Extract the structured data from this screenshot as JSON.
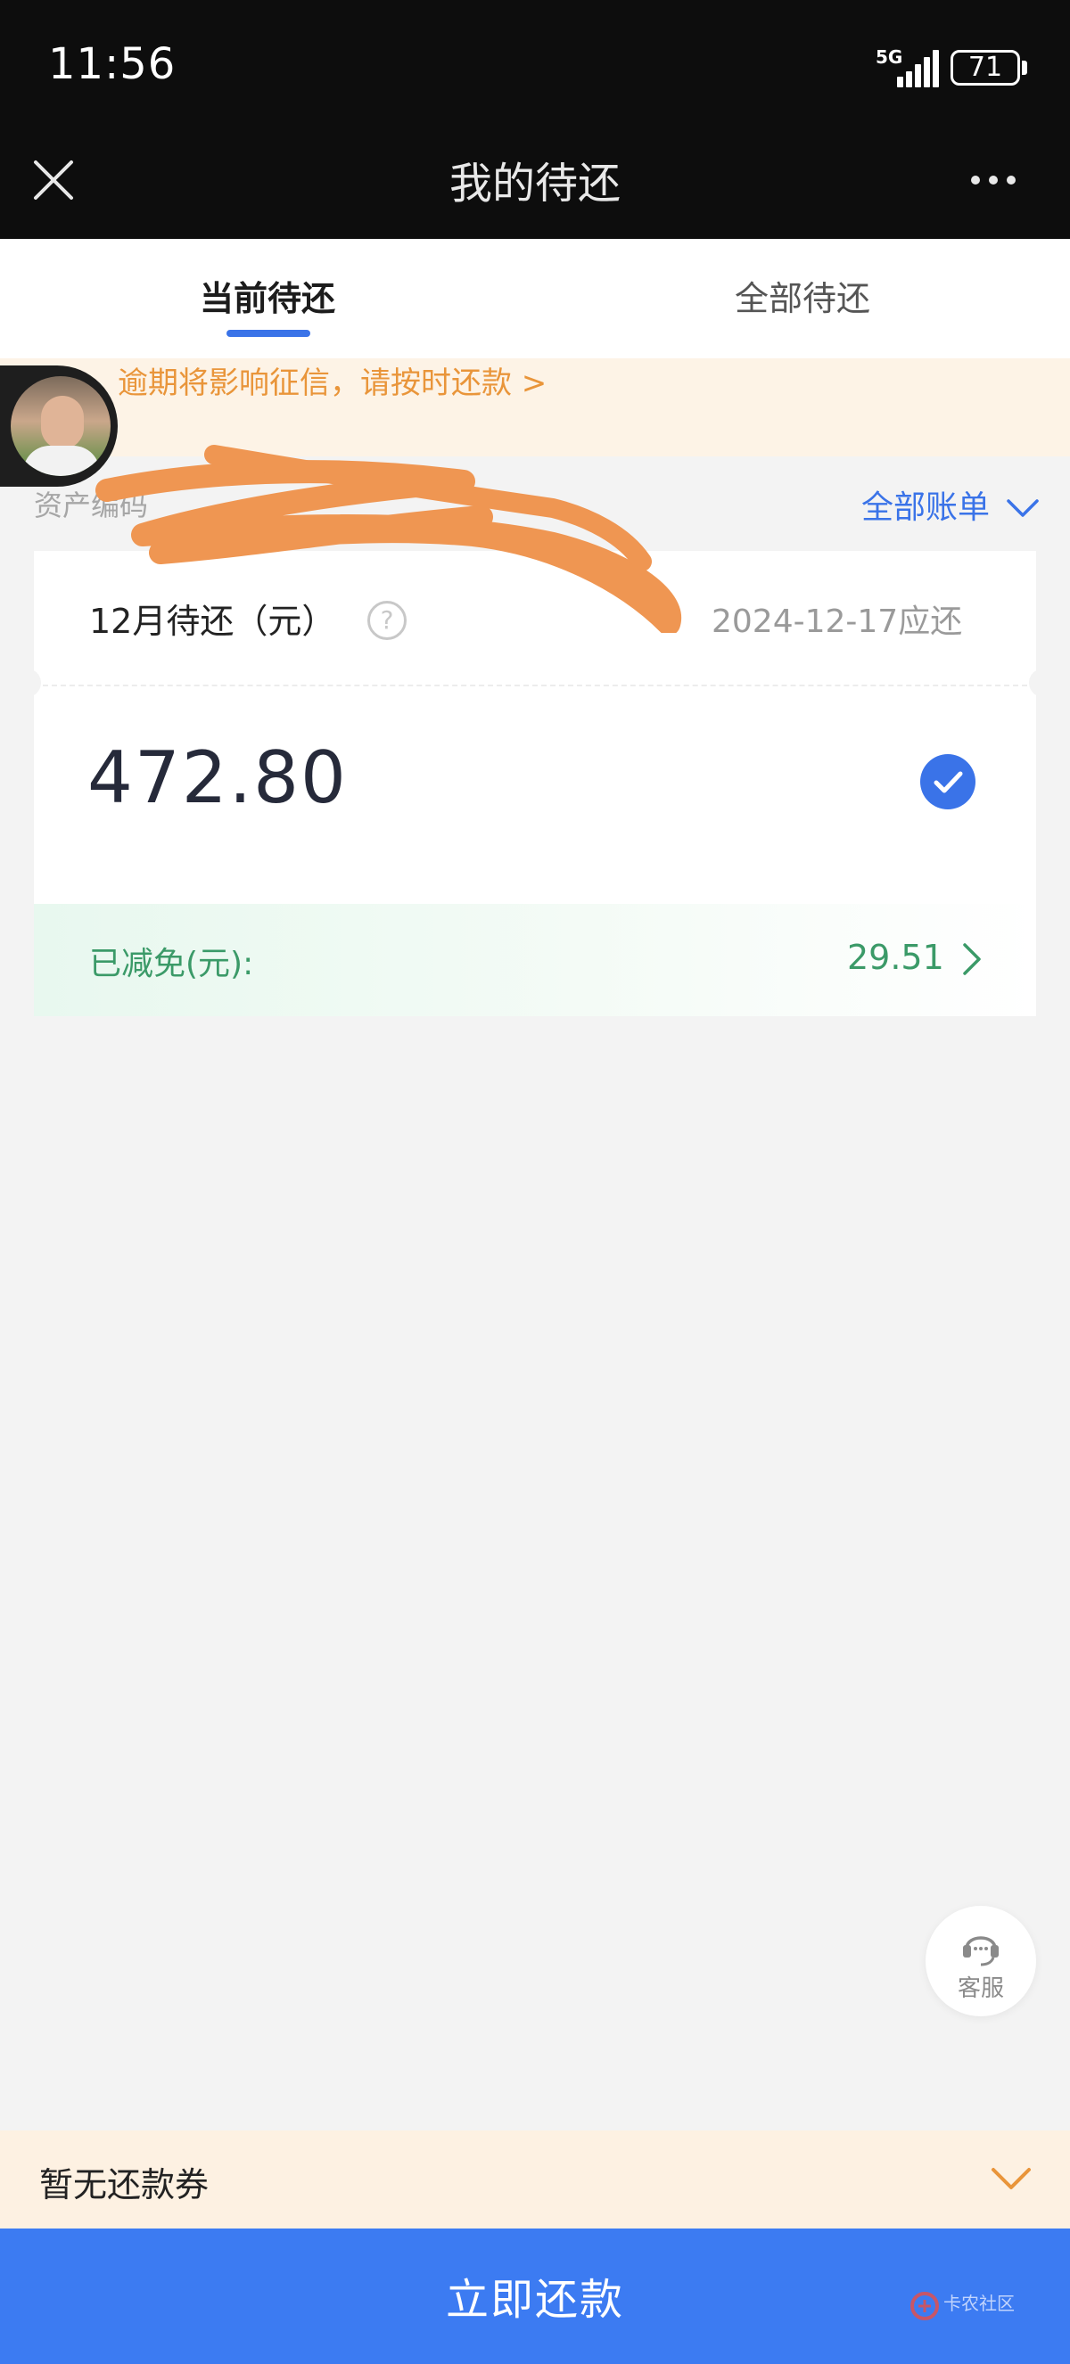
{
  "status_bar": {
    "time": "11:56",
    "network": "5G",
    "battery": "71"
  },
  "nav": {
    "title": "我的待还",
    "close_icon": "close-icon",
    "more_icon": "more-icon"
  },
  "tabs": [
    {
      "label": "当前待还",
      "active": true
    },
    {
      "label": "全部待还",
      "active": false
    }
  ],
  "notice": {
    "text": "逾期将影响征信，请按时还款 >"
  },
  "asset": {
    "label": "资产编码",
    "all_bills": "全部账单"
  },
  "bill_card": {
    "title": "12月待还（元）",
    "help_icon": "?",
    "due_date": "2024-12-17应还",
    "amount": "472.80",
    "selected": true,
    "reduction_label": "已减免(元):",
    "reduction_value": "29.51"
  },
  "service": {
    "label": "客服"
  },
  "coupon": {
    "text": "暂无还款券"
  },
  "pay_button": {
    "label": "立即还款"
  },
  "watermark": {
    "text": "卡农社区"
  },
  "colors": {
    "accent_blue": "#3a73e8",
    "notice_orange": "#e9953a",
    "reduction_green": "#3b9a68",
    "pay_button_blue": "#3c7bf2",
    "scribble_orange": "#ef9652"
  }
}
